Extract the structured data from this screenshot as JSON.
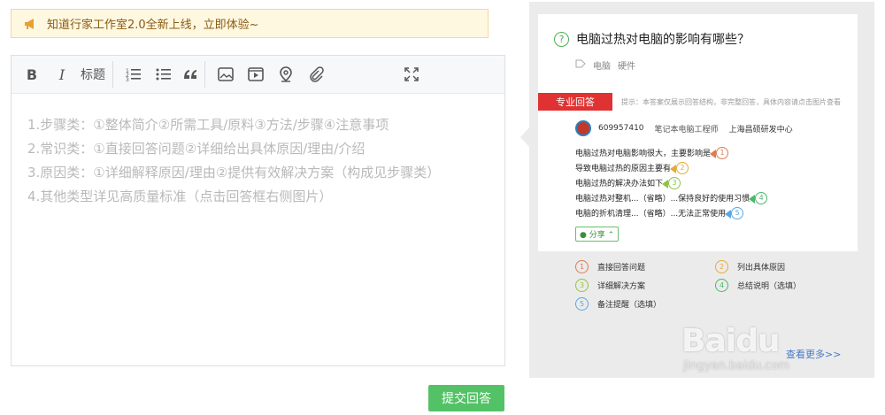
{
  "notice": {
    "text": "知道行家工作室2.0全新上线，立即体验~"
  },
  "toolbar": {
    "bold": "B",
    "italic": "I",
    "heading": "标题",
    "ordered_list": "1≡",
    "unordered_list": "≔",
    "quote": "“"
  },
  "editor": {
    "hints": [
      "1.步骤类：①整体简介②所需工具/原料③方法/步骤④注意事项",
      "2.常识类：①直接回答问题②详细给出具体原因/理由/介绍",
      "3.原因类：①详细解释原因/理由②提供有效解决方案（构成见步骤类）",
      "4.其他类型详见高质量标准（点击回答框右侧图片）"
    ]
  },
  "submit": {
    "label": "提交回答"
  },
  "sample": {
    "question": "电脑过热对电脑的影响有哪些？",
    "tags": [
      "电脑",
      "硬件"
    ],
    "pro_label": "专业回答",
    "pro_hint": "提示：本答案仅展示回答结构，非完整回答，具体内容请点击图片查看",
    "author": {
      "name": "609957410",
      "title": "笔记本电脑工程师",
      "org": "上海昌硕研发中心"
    },
    "answer_lines": [
      {
        "text": "电脑过热对电脑影响很大，主要影响是",
        "n": "1",
        "color": "#e07a4f"
      },
      {
        "text": "导致电脑过热的原因主要有",
        "n": "2",
        "color": "#e8a93b"
      },
      {
        "text": "电脑过热的解决办法如下",
        "n": "3",
        "color": "#8dc63f"
      },
      {
        "text": "电脑过热对整机...（省略）...保持良好的使用习惯",
        "n": "4",
        "color": "#4cb86a"
      },
      {
        "text": "电脑的折机清理...（省略）...无法正常使用",
        "n": "5",
        "color": "#5ba7e0"
      }
    ],
    "share": "分享",
    "legend": [
      {
        "n": "1",
        "text": "直接回答问题",
        "color": "#e07a4f"
      },
      {
        "n": "2",
        "text": "列出具体原因",
        "color": "#e8a93b"
      },
      {
        "n": "3",
        "text": "详细解决方案",
        "color": "#8dc63f"
      },
      {
        "n": "4",
        "text": "总结说明（选填）",
        "color": "#4cb86a"
      },
      {
        "n": "5",
        "text": "备注提醒（选填）",
        "color": "#5ba7e0"
      }
    ],
    "more": "查看更多>>"
  },
  "watermark": {
    "brand": "Baidu",
    "sub": "jingyan.baidu.com"
  }
}
